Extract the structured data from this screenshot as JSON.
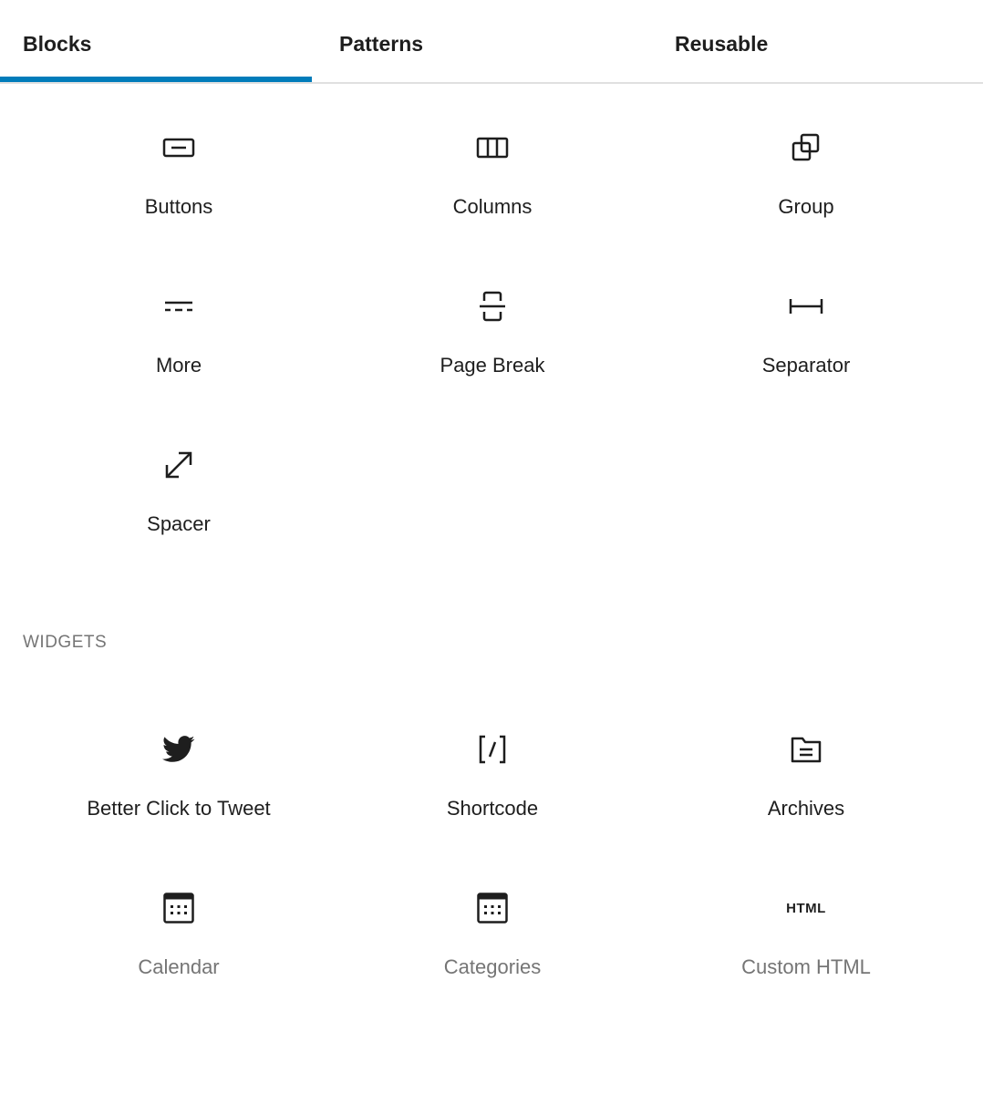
{
  "tabs": [
    {
      "label": "Blocks",
      "active": true
    },
    {
      "label": "Patterns",
      "active": false
    },
    {
      "label": "Reusable",
      "active": false
    }
  ],
  "accent_color": "#007cba",
  "design_blocks": [
    {
      "label": "Buttons",
      "icon": "buttons-icon"
    },
    {
      "label": "Columns",
      "icon": "columns-icon"
    },
    {
      "label": "Group",
      "icon": "group-icon"
    },
    {
      "label": "More",
      "icon": "more-icon"
    },
    {
      "label": "Page Break",
      "icon": "page-break-icon"
    },
    {
      "label": "Separator",
      "icon": "separator-icon"
    },
    {
      "label": "Spacer",
      "icon": "spacer-icon"
    }
  ],
  "widgets": {
    "title": "WIDGETS",
    "items": [
      {
        "label": "Better Click to Tweet",
        "icon": "twitter-icon"
      },
      {
        "label": "Shortcode",
        "icon": "shortcode-icon"
      },
      {
        "label": "Archives",
        "icon": "archives-icon"
      },
      {
        "label": "Calendar",
        "icon": "calendar-icon"
      },
      {
        "label": "Categories",
        "icon": "categories-icon"
      },
      {
        "label": "Custom HTML",
        "icon": "html-icon",
        "icon_text": "HTML"
      }
    ]
  }
}
